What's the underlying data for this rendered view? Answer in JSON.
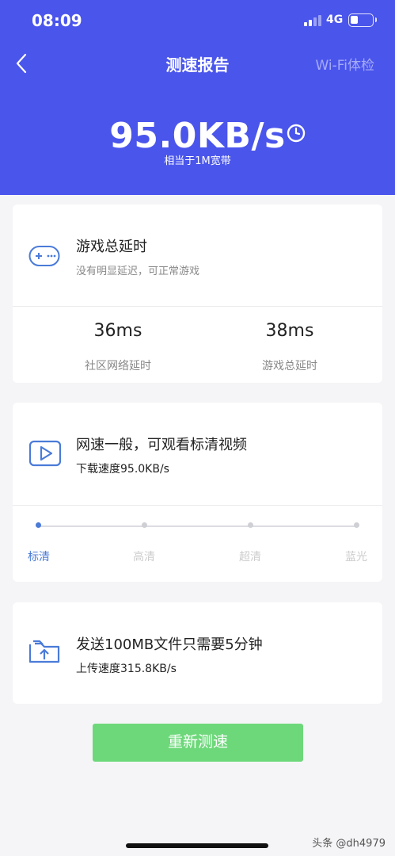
{
  "status_bar": {
    "time": "08:09",
    "network": "4G"
  },
  "nav": {
    "title": "测速报告",
    "right_action": "Wi-Fi体检"
  },
  "speed_summary": {
    "speed": "95.0KB/s",
    "equivalent": "相当于1M宽带"
  },
  "game_card": {
    "title": "游戏总延时",
    "subtitle": "没有明显延迟，可正常游戏",
    "stats": [
      {
        "value": "36ms",
        "label": "社区网络延时"
      },
      {
        "value": "38ms",
        "label": "游戏总延时"
      }
    ]
  },
  "video_card": {
    "title": "网速一般，可观看标清视频",
    "subtitle": "下载速度95.0KB/s",
    "quality_levels": [
      "标清",
      "高清",
      "超清",
      "蓝光"
    ],
    "active_level": "标清"
  },
  "upload_card": {
    "title": "发送100MB文件只需要5分钟",
    "subtitle": "上传速度315.8KB/s"
  },
  "retest_button": "重新测速",
  "watermark": "头条 @dh4979",
  "colors": {
    "header": "#4a55ec",
    "accent": "#4a7bd8",
    "button": "#6dd87a"
  },
  "icons": [
    "back-icon",
    "clock-icon",
    "gamepad-icon",
    "video-play-icon",
    "upload-folder-icon"
  ]
}
